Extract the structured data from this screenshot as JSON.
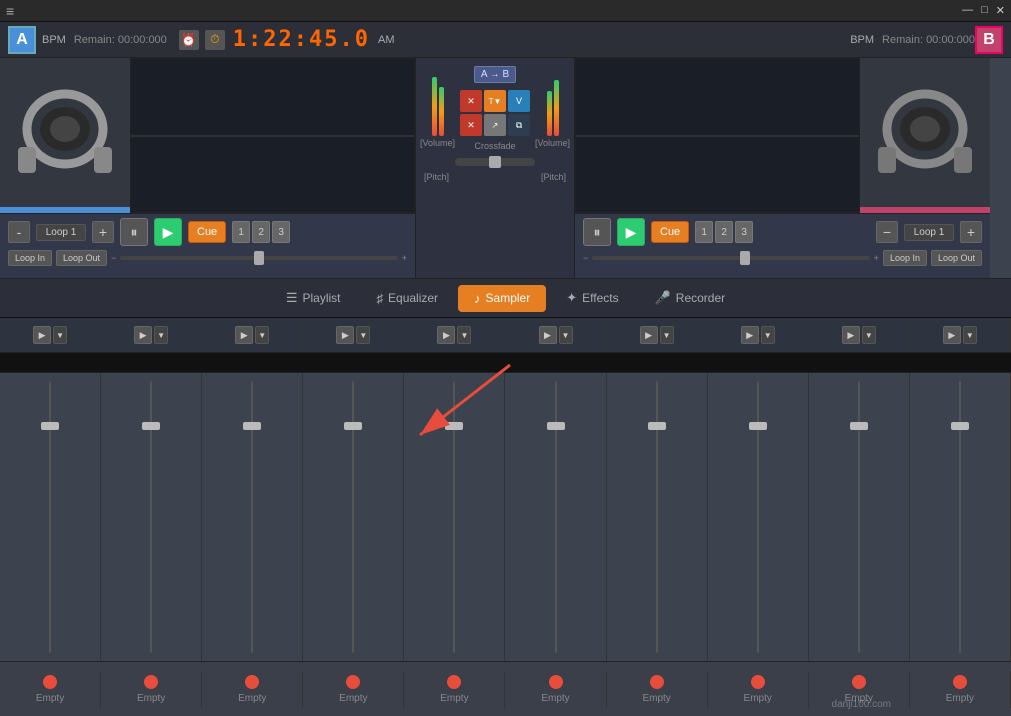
{
  "titlebar": {
    "menu_icon": "≡",
    "win_minimize": "—",
    "win_maximize": "□",
    "win_close": "✕"
  },
  "deck_a": {
    "badge": "A",
    "bpm_label": "BPM",
    "remain_label": "Remain: 00:00:000",
    "loop_name": "Loop 1",
    "loop_in": "Loop In",
    "loop_out": "Loop Out",
    "cue_label": "Cue",
    "cue_nums": [
      "1",
      "2",
      "3"
    ],
    "pitch_minus": "-",
    "pitch_plus": "+"
  },
  "deck_b": {
    "badge": "B",
    "bpm_label": "BPM",
    "remain_label": "Remain: 00:00:000",
    "loop_name": "Loop 1",
    "loop_in": "Loop In",
    "loop_out": "Loop Out",
    "cue_label": "Cue",
    "cue_nums": [
      "1",
      "2",
      "3"
    ],
    "pitch_minus": "-",
    "pitch_plus": "+"
  },
  "mixer": {
    "ab_btn": "A → B",
    "crossfade_label": "Crossfade",
    "vol_label_left": "[Volume]",
    "vol_label_right": "[Volume]",
    "pitch_label_left": "[Pitch]",
    "pitch_label_right": "[Pitch]"
  },
  "timer": {
    "main_time": "1:22:45.0",
    "am_label": "AM"
  },
  "nav_tabs": [
    {
      "id": "playlist",
      "icon": "☰",
      "label": "Playlist",
      "active": false
    },
    {
      "id": "equalizer",
      "icon": "♯",
      "label": "Equalizer",
      "active": false
    },
    {
      "id": "sampler",
      "icon": "♪",
      "label": "Sampler",
      "active": true
    },
    {
      "id": "effects",
      "icon": "✦",
      "label": "Effects",
      "active": false
    },
    {
      "id": "recorder",
      "icon": "🎤",
      "label": "Recorder",
      "active": false
    }
  ],
  "sampler": {
    "channels": [
      {
        "empty_label": "Empty"
      },
      {
        "empty_label": "Empty"
      },
      {
        "empty_label": "Empty"
      },
      {
        "empty_label": "Empty"
      },
      {
        "empty_label": "Empty"
      },
      {
        "empty_label": "Empty"
      },
      {
        "empty_label": "Empty"
      },
      {
        "empty_label": "Empty"
      },
      {
        "empty_label": "Empty"
      },
      {
        "empty_label": "Empty"
      }
    ]
  },
  "fx_buttons": [
    {
      "label": "✕",
      "style": "red"
    },
    {
      "label": "T▼",
      "style": "orange"
    },
    {
      "label": "V",
      "style": "blue"
    },
    {
      "label": "✕",
      "style": "red"
    },
    {
      "label": "↗↙",
      "style": "gray"
    },
    {
      "label": "⧉",
      "style": "dark"
    }
  ],
  "watermark": "danji100.com"
}
